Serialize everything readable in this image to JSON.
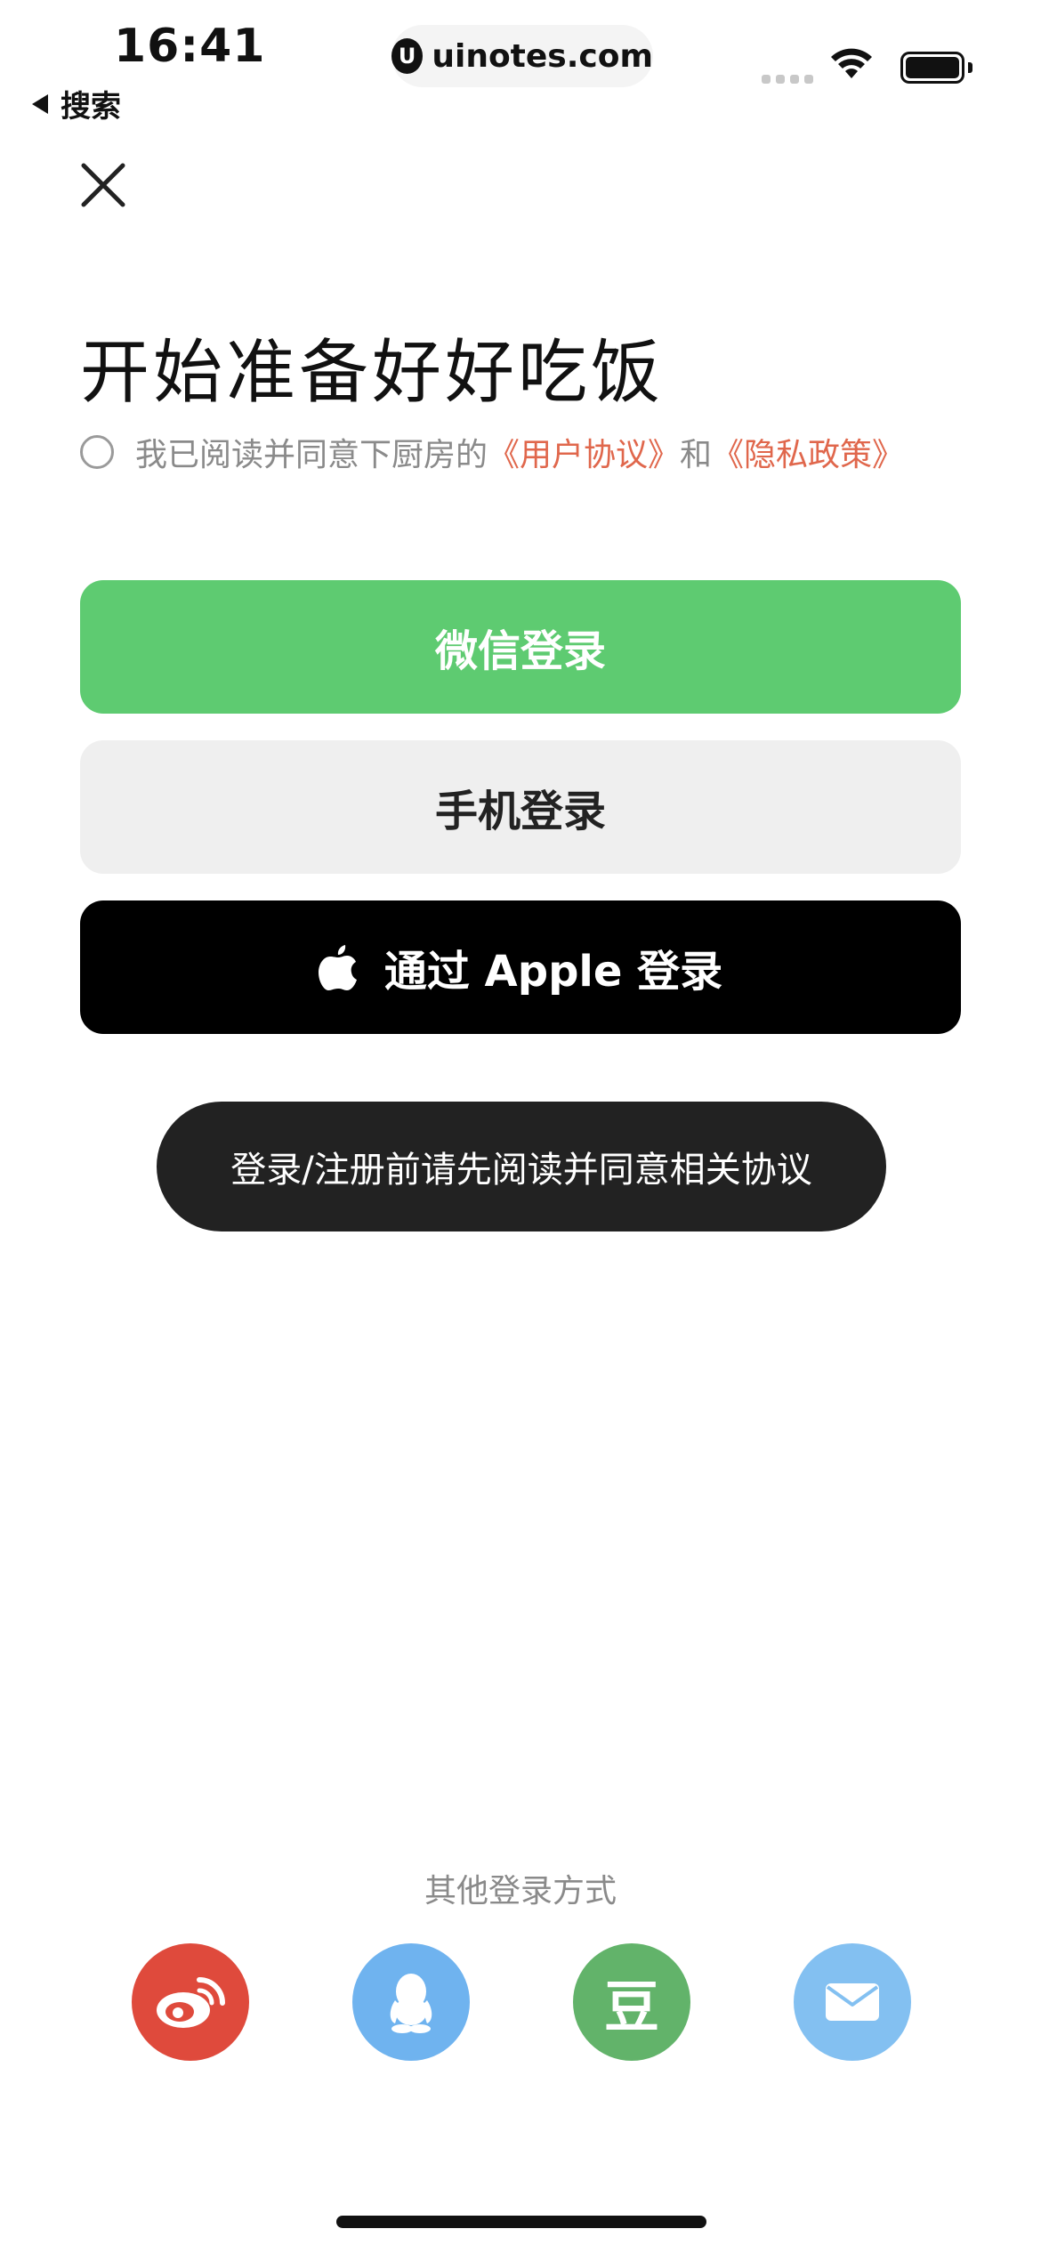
{
  "status_bar": {
    "time": "16:41",
    "back_label": "搜索",
    "url": "uinotes.com"
  },
  "header": {
    "close_icon": "close-icon"
  },
  "title": "开始准备好好吃饭",
  "agreement": {
    "prefix": "我已阅读并同意下厨房的",
    "user_agreement": "《用户协议》",
    "and": "和",
    "privacy_policy": "《隐私政策》",
    "checked": false
  },
  "buttons": {
    "wechat": "微信登录",
    "phone": "手机登录",
    "apple": "通过 Apple 登录"
  },
  "toast": "登录/注册前请先阅读并同意相关协议",
  "other_login": {
    "label": "其他登录方式",
    "douban_glyph": "豆",
    "items": [
      "weibo-icon",
      "qq-icon",
      "douban-icon",
      "mail-icon"
    ]
  },
  "colors": {
    "wechat_green": "#5ecb71",
    "link_orange": "#e0674c",
    "weibo_red": "#df4a3c",
    "qq_blue": "#6fb3ef",
    "douban_green": "#62b36a",
    "mail_blue": "#83c0f1"
  }
}
